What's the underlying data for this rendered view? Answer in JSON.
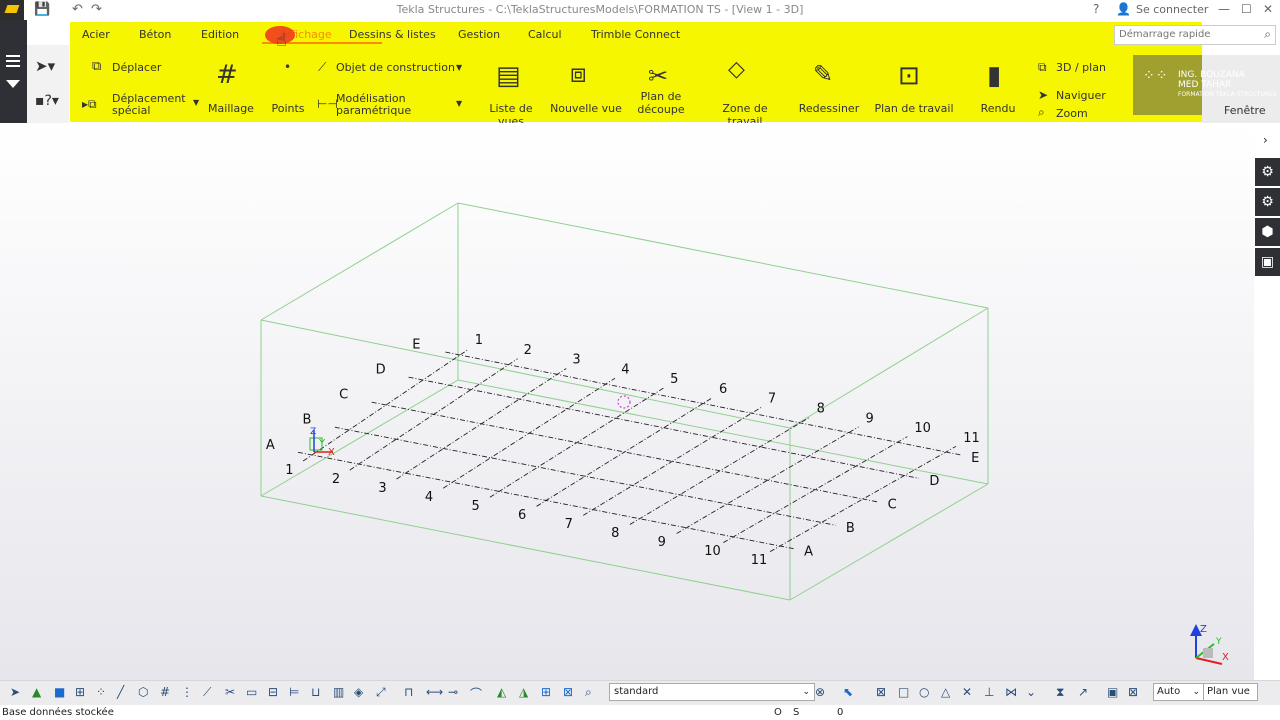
{
  "window": {
    "title": "Tekla Structures - C:\\TeklaStructuresModels\\FORMATION TS  - [View 1 - 3D]",
    "help": "?",
    "login": "Se connecter"
  },
  "menu": {
    "tabs": [
      "Acier",
      "Béton",
      "Edition",
      "Affichage",
      "Dessins & listes",
      "Gestion",
      "Calcul",
      "Trimble Connect"
    ],
    "active_tab": "Affichage"
  },
  "search": {
    "placeholder": "Démarrage rapide"
  },
  "ribbon": {
    "deplacer": "Déplacer",
    "deplacement_special": "Déplacement\nspécial",
    "maillage": "Maillage",
    "points": "Points",
    "objet_construction": "Objet de construction",
    "modelisation_parametrique": "Modélisation\nparamétrique",
    "liste_vues": "Liste de vues",
    "nouvelle_vue": "Nouvelle vue",
    "plan_decoupe": "Plan de\ndécoupe",
    "zone_travail": "Zone de travail",
    "redessiner": "Redessiner",
    "plan_travail": "Plan de travail",
    "rendu": "Rendu",
    "vue_3d_plan": "3D / plan",
    "naviguer": "Naviguer",
    "zoom": "Zoom",
    "fenetre": "Fenêtre"
  },
  "watermark": {
    "line1": "ING. BOUZANA",
    "line2": "MED TAHAR",
    "line3": "FORMATION TEKLA STRUCTURES"
  },
  "grid": {
    "numbers": [
      "1",
      "2",
      "3",
      "4",
      "5",
      "6",
      "7",
      "8",
      "9",
      "10",
      "11"
    ],
    "letters": [
      "A",
      "B",
      "C",
      "D",
      "E"
    ]
  },
  "axes": {
    "x": "X",
    "y": "Y",
    "z": "Z"
  },
  "bottom": {
    "view_filter": "standard",
    "auto": "Auto",
    "plan_vue": "Plan vue"
  },
  "status": {
    "message": "Base données stockée",
    "o": "O",
    "s": "S",
    "value": "0"
  },
  "colors": {
    "ribbon_highlight": "#f6f600",
    "active_tab": "#ff8a00",
    "work_area_box": "#8fd08f",
    "dark_panel": "#2f3035"
  }
}
